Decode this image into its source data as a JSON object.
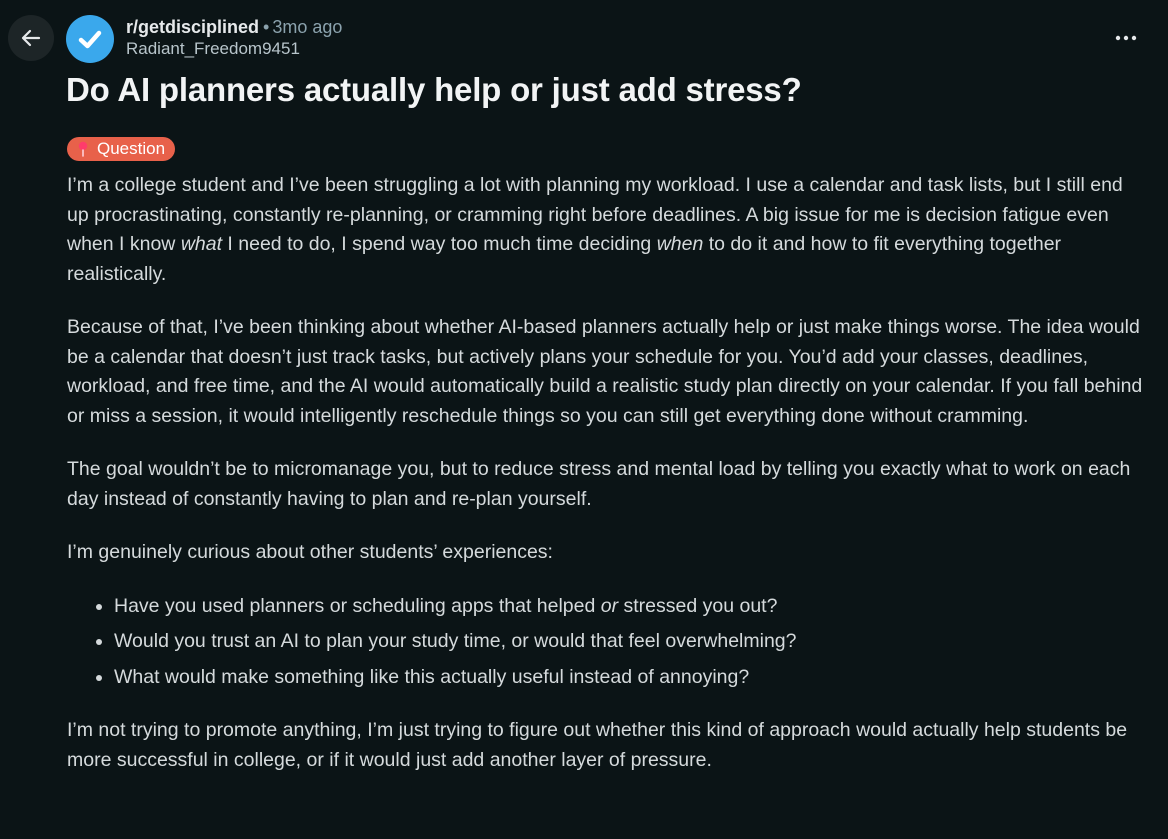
{
  "header": {
    "subreddit": "r/getdisciplined",
    "separator": "•",
    "time_ago": "3mo ago",
    "author": "Radiant_Freedom9451"
  },
  "post": {
    "title": "Do AI planners actually help or just add stress?",
    "flair": "Question",
    "p1_a": "I’m a college student and I’ve been struggling a lot with planning my workload. I use a calendar and task lists, but I still end up procrastinating, constantly re-planning, or cramming right before deadlines. A big issue for me is decision fatigue even when I know ",
    "p1_em1": "what",
    "p1_b": " I need to do, I spend way too much time deciding ",
    "p1_em2": "when",
    "p1_c": " to do it and how to fit everything together realistically.",
    "p2": "Because of that, I’ve been thinking about whether AI-based planners actually help or just make things worse. The idea would be a calendar that doesn’t just track tasks, but actively plans your schedule for you. You’d add your classes, deadlines, workload, and free time, and the AI would automatically build a realistic study plan directly on your calendar. If you fall behind or miss a session, it would intelligently reschedule things so you can still get everything done without cramming.",
    "p3": "The goal wouldn’t be to micromanage you, but to reduce stress and mental load by telling you exactly what to work on each day instead of constantly having to plan and re-plan yourself.",
    "p4": "I’m genuinely curious about other students’ experiences:",
    "bullet1_a": "Have you used planners or scheduling apps that helped ",
    "bullet1_em": "or",
    "bullet1_b": " stressed you out?",
    "bullet2": "Would you trust an AI to plan your study time, or would that feel overwhelming?",
    "bullet3": "What would make something like this actually useful instead of annoying?",
    "p5": "I’m not trying to promote anything, I’m just trying to figure out whether this kind of approach would actually help students be more successful in college, or if it would just add another layer of pressure."
  },
  "icons": {
    "back": "arrow-left-icon",
    "avatar": "checkmark-icon",
    "more": "more-horizontal-icon",
    "flair": "pin-icon"
  },
  "colors": {
    "background": "#0b1416",
    "avatar": "#3aa8ec",
    "flair": "#e8614a"
  }
}
